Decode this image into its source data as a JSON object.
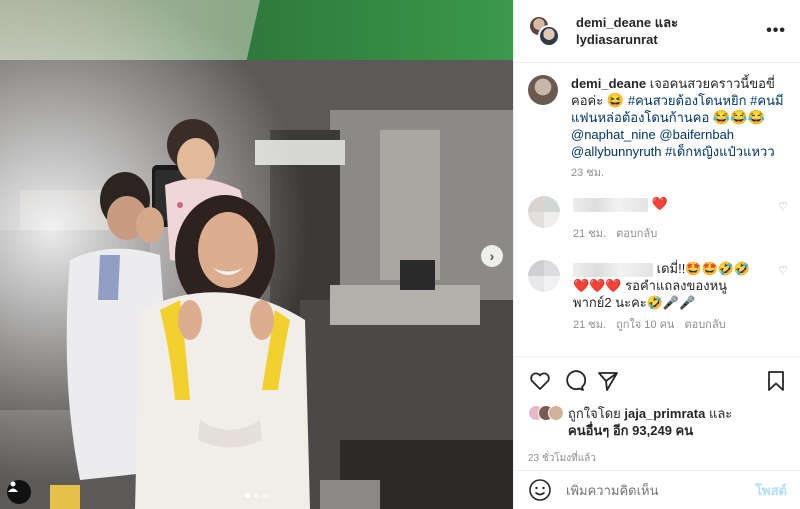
{
  "header": {
    "names_line1": "demi_deane และ",
    "names_line2": "lydiasarunrat",
    "more_icon": "more-horizontal-icon"
  },
  "caption": {
    "username": "demi_deane",
    "text1": "เจอคนสวยคราวนี้ขอขี่คอค่ะ",
    "emoji1": "😆",
    "tag1": "#คนสวยต้องโดนหยิก",
    "tag2": "#คนมีแฟนหล่อต้องโดนก้านคอ",
    "emoji2": "😂😂😂",
    "mention1": "@naphat_nine",
    "mention2": "@baifernbah",
    "mention3": "@allybunnyruth",
    "tag3": "#เด็กหญิงแป๋วแหวว",
    "time": "23 ชม."
  },
  "comments": [
    {
      "text": "❤️",
      "time": "21 ชม.",
      "reply": "ตอบกลับ",
      "likes": ""
    },
    {
      "text1": "เดมี่!!🤩🤩🤣🤣",
      "text2": "❤️❤️❤️ รอคำแถลงของหนู",
      "text3": "พากย์2 นะคะ🤣🎤🎤",
      "time": "21 ชม.",
      "likes": "ถูกใจ 10 คน",
      "reply": "ตอบกลับ"
    }
  ],
  "likes": {
    "prefix": "ถูกใจโดย",
    "user": "jaja_primrata",
    "mid": "และ",
    "others": "คนอื่นๆ อีก 93,249 คน"
  },
  "post_time": "23 ชั่วโมงที่แล้ว",
  "add_comment": {
    "placeholder": "เพิ่มความคิดเห็น",
    "post": "โพสต์"
  },
  "colors": {
    "tag": "#00376b",
    "muted": "#8e8e8e",
    "post_button": "#b2dffc"
  }
}
